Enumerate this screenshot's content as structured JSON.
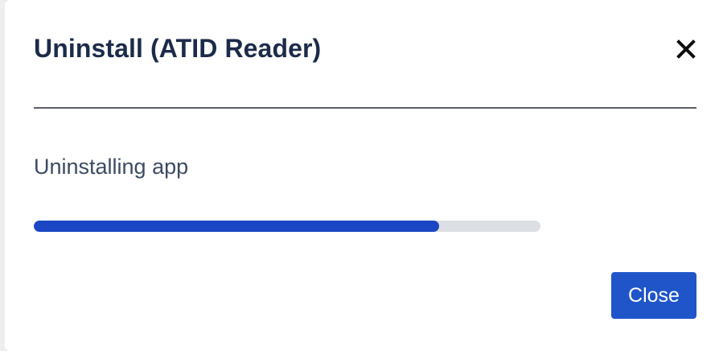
{
  "dialog": {
    "title": "Uninstall (ATID Reader)",
    "close_icon": "close-icon",
    "status_text": "Uninstalling app",
    "progress": {
      "fraction": 0.8
    },
    "close_button_label": "Close"
  },
  "colors": {
    "title": "#1c2b4a",
    "text": "#3c4a63",
    "progress_fill": "#1b47c4",
    "progress_track": "#dcdfe3",
    "primary_button": "#1f55c9",
    "divider": "#5b5f66"
  }
}
